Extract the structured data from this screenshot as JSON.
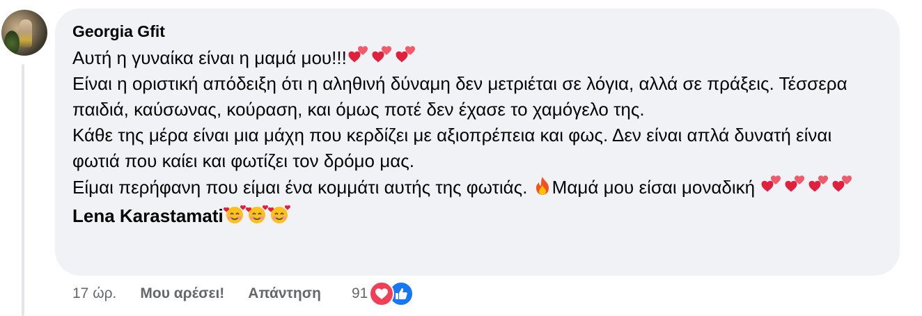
{
  "comment": {
    "author": "Georgia Gfit",
    "lines": [
      "Αυτή η γυναίκα είναι η μαμά μου!!!",
      "Είναι η οριστική απόδειξη ότι η αληθινή δύναμη δεν μετριέται σε λόγια, αλλά σε πράξεις. Τέσσερα παιδιά, καύσωνας, κούραση, και όμως ποτέ δεν έχασε το χαμόγελο της.",
      "Κάθε της μέρα είναι μια μάχη που κερδίζει με αξιοπρέπεια και φως. Δεν είναι απλά δυνατή είναι φωτιά που καίει και φωτίζει τον δρόμο μας.",
      "Είμαι περήφανη που είμαι ένα κομμάτι αυτής της φωτιάς. ",
      "Μαμά μου είσαι μοναδική "
    ],
    "mention": "Lena Karastamati",
    "icons": {
      "heart": "two-hearts-icon",
      "fire": "fire-icon",
      "smile": "smiling-face-with-hearts-icon"
    }
  },
  "actions": {
    "time": "17 ώρ.",
    "like_label": "Μου αρέσει!",
    "reply_label": "Απάντηση",
    "reaction_count": "91"
  },
  "colors": {
    "bubble": "#f0f2f5",
    "secondary_text": "#65676b",
    "love": "#f33e58",
    "like": "#1877f2"
  }
}
